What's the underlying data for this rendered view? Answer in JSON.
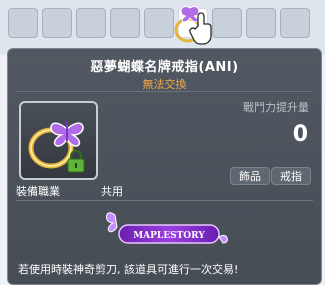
{
  "item": {
    "name": "惡夢蝴蝶名牌戒指(ANI)",
    "trade_status": "無法交換",
    "stat_label": "戰鬥力提升量",
    "stat_value": "0",
    "job_label": "裝備職業",
    "job_value": "共用",
    "tags": [
      "飾品",
      "戒指"
    ],
    "badge_text": "MAPLESTORY",
    "description": "若使用時裝神奇剪刀, 該道具可進行一次交易!"
  },
  "colors": {
    "tooltip_bg": "#4d545c",
    "title": "#ffffff",
    "trade_status": "#f5a94a",
    "ring_gold": "#e7b43a",
    "butterfly": "#b06ce8"
  },
  "icons": {
    "item": "butterfly-ring-icon",
    "lock": "lock-icon",
    "cursor": "glove-cursor-icon"
  }
}
